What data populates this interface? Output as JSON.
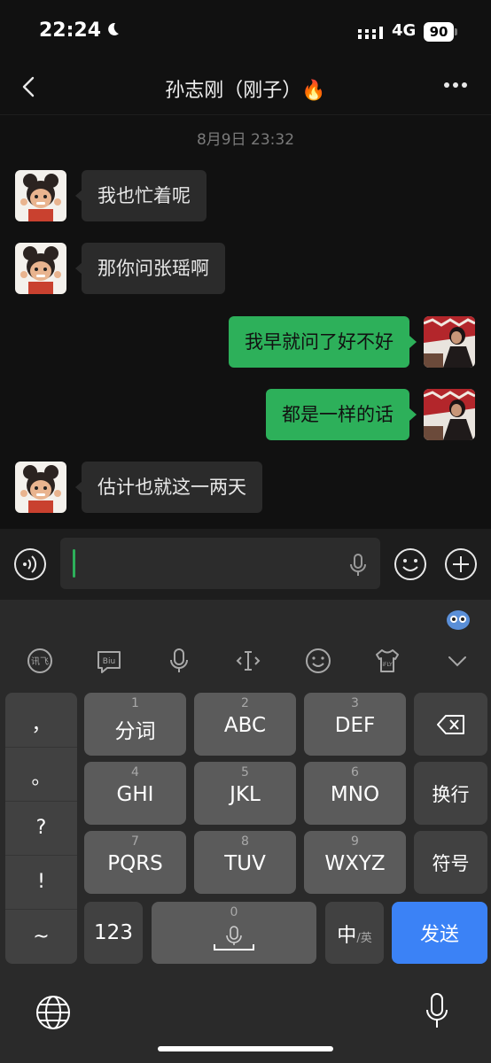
{
  "status": {
    "time": "22:24",
    "network": "4G",
    "battery": "90"
  },
  "nav": {
    "title": "孙志刚（刚子）🔥"
  },
  "timestamp": "8月9日 23:32",
  "messages": [
    {
      "side": "left",
      "text": "我也忙着呢"
    },
    {
      "side": "left",
      "text": "那你问张瑶啊"
    },
    {
      "side": "right",
      "text": "我早就问了好不好"
    },
    {
      "side": "right",
      "text": "都是一样的话"
    },
    {
      "side": "left",
      "text": "估计也就这一两天"
    }
  ],
  "keyboard": {
    "punctuation": [
      "，",
      "。",
      "?",
      "!",
      "~"
    ],
    "row1": [
      {
        "num": "1",
        "label": "分词"
      },
      {
        "num": "2",
        "label": "ABC"
      },
      {
        "num": "3",
        "label": "DEF"
      }
    ],
    "row2": [
      {
        "num": "4",
        "label": "GHI"
      },
      {
        "num": "5",
        "label": "JKL"
      },
      {
        "num": "6",
        "label": "MNO"
      }
    ],
    "row3": [
      {
        "num": "7",
        "label": "PQRS"
      },
      {
        "num": "8",
        "label": "TUV"
      },
      {
        "num": "9",
        "label": "WXYZ"
      }
    ],
    "newline": "换行",
    "symbols": "符号",
    "numbers": "123",
    "space_num": "0",
    "lang_main": "中",
    "lang_sub": "/英",
    "send": "发送"
  },
  "colors": {
    "bubble_right": "#2db05a",
    "bubble_left": "#2b2b2b",
    "send_key": "#3b82f6"
  }
}
